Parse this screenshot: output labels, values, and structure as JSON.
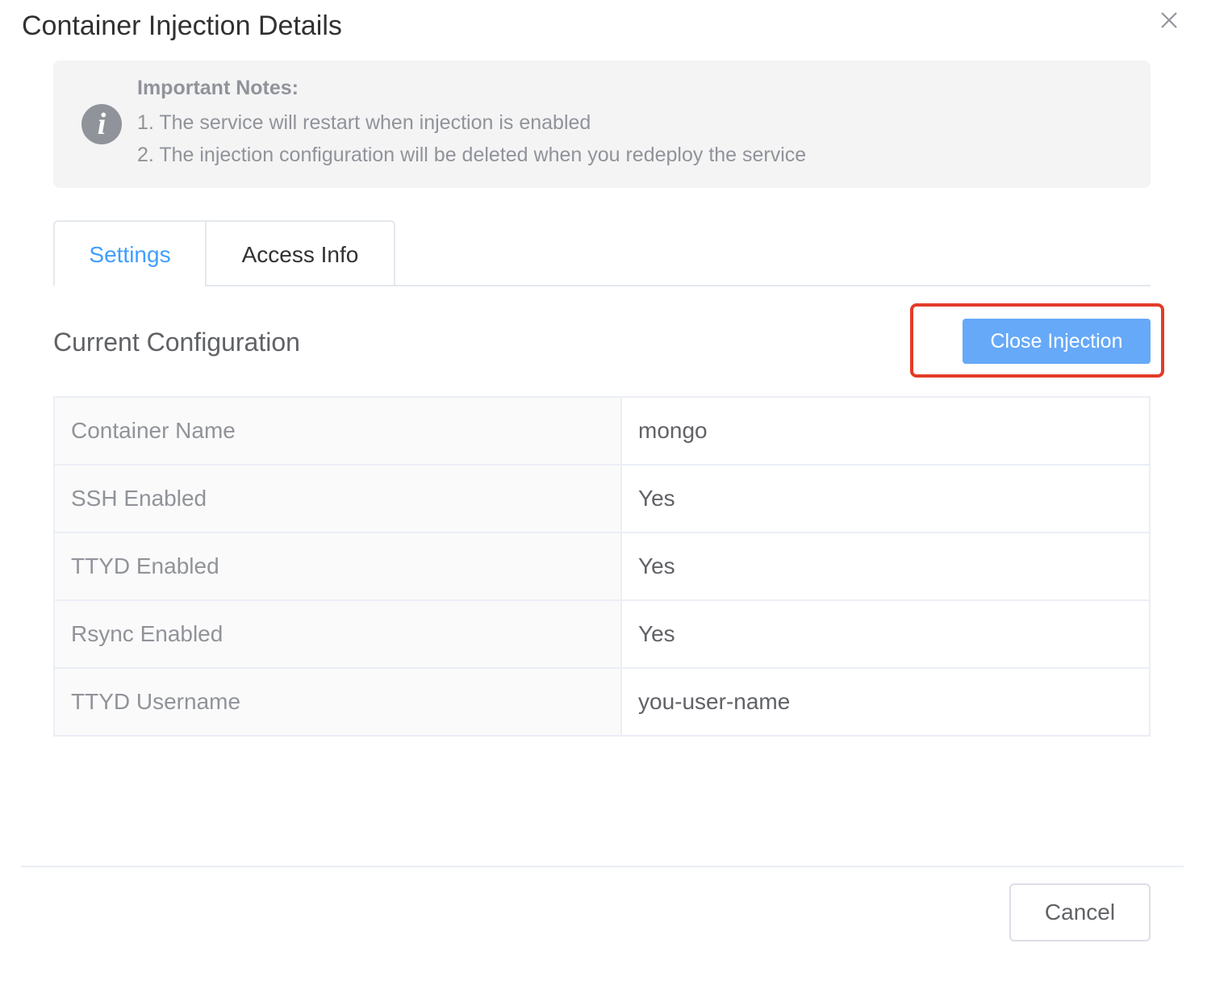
{
  "dialog": {
    "title": "Container Injection Details",
    "close_icon": "close-icon"
  },
  "notice": {
    "icon": "info-icon",
    "icon_glyph": "i",
    "title": "Important Notes:",
    "lines": [
      "1. The service will restart when injection is enabled",
      "2. The injection configuration will be deleted when you redeploy the service"
    ]
  },
  "tabs": [
    {
      "label": "Settings",
      "active": true
    },
    {
      "label": "Access Info",
      "active": false
    }
  ],
  "section": {
    "title": "Current Configuration",
    "close_injection_label": "Close Injection"
  },
  "config_rows": [
    {
      "key": "Container Name",
      "value": "mongo"
    },
    {
      "key": "SSH Enabled",
      "value": "Yes"
    },
    {
      "key": "TTYD Enabled",
      "value": "Yes"
    },
    {
      "key": "Rsync Enabled",
      "value": "Yes"
    },
    {
      "key": "TTYD Username",
      "value": "you-user-name"
    }
  ],
  "footer": {
    "cancel_label": "Cancel"
  },
  "colors": {
    "accent": "#409eff",
    "primary_button": "#66a9f8",
    "highlight_border": "#e33b27",
    "notice_bg": "#f4f4f5",
    "muted_text": "#909399"
  }
}
